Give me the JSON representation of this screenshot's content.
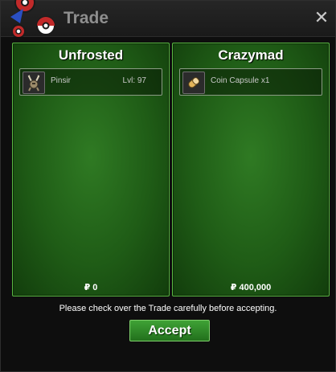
{
  "window": {
    "title": "Trade",
    "close_label": "✕"
  },
  "panels": [
    {
      "player": "Unfrosted",
      "item": {
        "icon": "pinsir-icon",
        "name": "Pinsir",
        "level": "Lvl: 97"
      },
      "money": "₽ 0"
    },
    {
      "player": "Crazymad",
      "item": {
        "icon": "coin-capsule-icon",
        "name": "Coin Capsule x1"
      },
      "money": "₽ 400,000"
    }
  ],
  "notice": "Please check over the Trade carefully before accepting.",
  "accept_label": "Accept",
  "colors": {
    "panel_border": "#59b842",
    "panel_fill": "#1f5c16",
    "accept": "#2e8a27"
  }
}
